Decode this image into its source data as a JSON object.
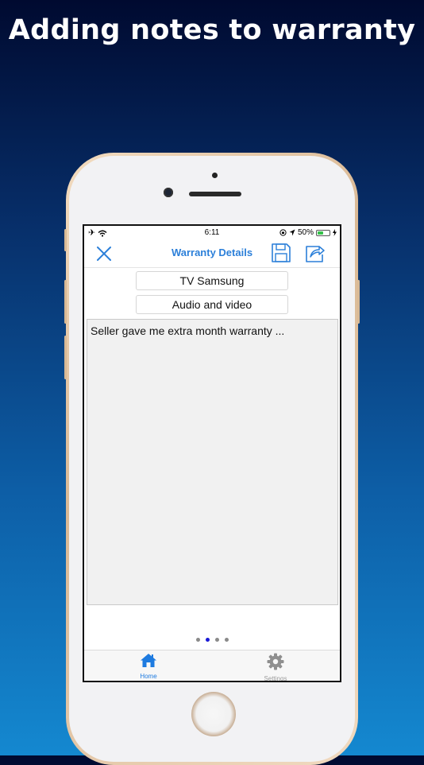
{
  "headline": "Adding notes to warranty",
  "status_bar": {
    "time": "6:11",
    "battery_percent": "50%",
    "battery_level": 0.5
  },
  "nav": {
    "title": "Warranty Details"
  },
  "fields": {
    "product_name": "TV Samsung",
    "category": "Audio and video"
  },
  "notes": {
    "text": "Seller gave me extra month warranty ..."
  },
  "pager": {
    "count": 4,
    "active_index": 1
  },
  "tabs": [
    {
      "label": "Home",
      "icon": "home-icon",
      "active": true
    },
    {
      "label": "Settings",
      "icon": "gear-icon",
      "active": false
    }
  ],
  "colors": {
    "accent": "#2b7fd9",
    "tab_active": "#1e7be0",
    "tab_inactive": "#9a9a9a",
    "page_dot_active": "#1919d6"
  }
}
